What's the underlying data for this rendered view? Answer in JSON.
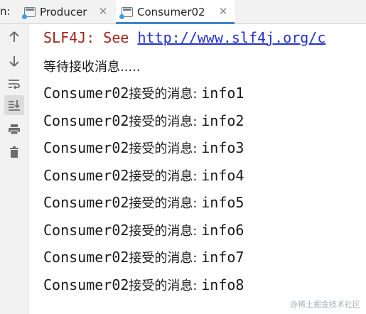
{
  "tabbar": {
    "prefix": "n:",
    "tabs": [
      {
        "label": "Producer",
        "active": false
      },
      {
        "label": "Consumer02",
        "active": true
      }
    ],
    "close_glyph": "✕"
  },
  "toolbar": {
    "icons": [
      "up-arrow-icon",
      "down-arrow-icon",
      "soft-wrap-icon",
      "scroll-to-end-icon",
      "print-icon",
      "trash-icon"
    ]
  },
  "console": {
    "slf4j_prefix": "SLF4J: See ",
    "slf4j_link": "http://www.slf4j.org/c",
    "waiting": "等待接收消息.....",
    "msg_prefix_latin": "Consumer02",
    "msg_prefix_cjk": "接受的消息: ",
    "messages": [
      "info1",
      "info2",
      "info3",
      "info4",
      "info5",
      "info6",
      "info7",
      "info8"
    ]
  },
  "watermark": "@稀土掘金技术社区",
  "colors": {
    "accent": "#4083c9",
    "warning_text": "#a0231c",
    "link": "#2233cc"
  }
}
